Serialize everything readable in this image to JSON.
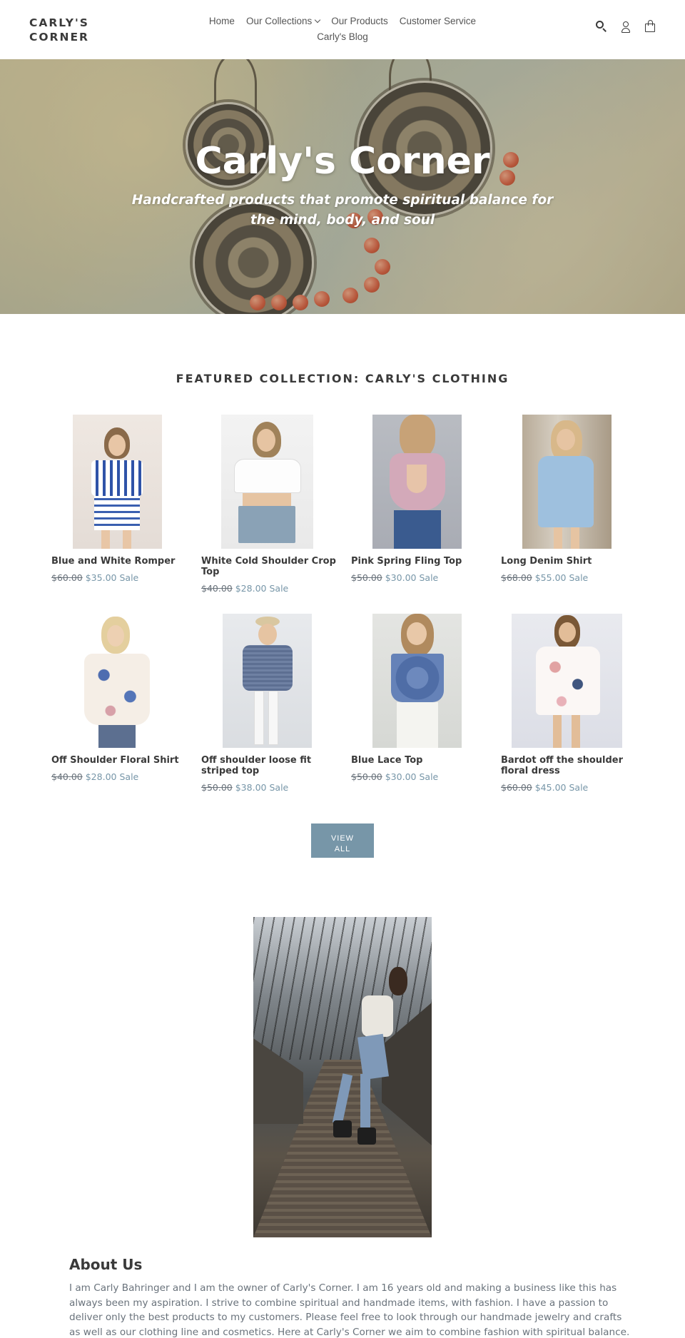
{
  "header": {
    "logo": "CARLY'S CORNER",
    "nav": [
      "Home",
      "Our Collections",
      "Our Products",
      "Customer Service",
      "Carly's Blog"
    ],
    "icons": [
      "search-icon",
      "user-icon",
      "cart-icon"
    ]
  },
  "hero": {
    "title": "Carly's Corner",
    "subtitle": "Handcrafted products that promote spiritual balance for the mind, body, and soul"
  },
  "featured": {
    "title": "FEATURED COLLECTION: CARLY'S CLOTHING",
    "products": [
      {
        "name": "Blue and White Romper",
        "old": "$60.00",
        "new": "$35.00",
        "sale": "Sale"
      },
      {
        "name": "White Cold Shoulder Crop Top",
        "old": "$40.00",
        "new": "$28.00",
        "sale": "Sale"
      },
      {
        "name": "Pink Spring Fling Top",
        "old": "$50.00",
        "new": "$30.00",
        "sale": "Sale"
      },
      {
        "name": "Long Denim Shirt",
        "old": "$68.00",
        "new": "$55.00",
        "sale": "Sale"
      },
      {
        "name": "Off Shoulder Floral Shirt",
        "old": "$40.00",
        "new": "$28.00",
        "sale": "Sale"
      },
      {
        "name": "Off shoulder loose fit striped top",
        "old": "$50.00",
        "new": "$38.00",
        "sale": "Sale"
      },
      {
        "name": "Blue Lace Top",
        "old": "$50.00",
        "new": "$30.00",
        "sale": "Sale"
      },
      {
        "name": "Bardot off the shoulder floral dress",
        "old": "$60.00",
        "new": "$45.00",
        "sale": "Sale"
      }
    ],
    "view_all_line1": "VIEW",
    "view_all_line2": "ALL"
  },
  "about": {
    "title": "About Us",
    "text": "I am Carly Bahringer and I am the owner of Carly's Corner. I am 16 years old and making a business like this has always been my aspiration. I strive to combine spiritual and handmade items, with fashion. I have a passion to deliver only the best products to my customers. Please feel free to look through our handmade jewelry and crafts as well as our clothing line and cosmetics. Here at Carly's Corner we aim to combine fashion with spiritual balance. This is"
  },
  "colors": {
    "accent": "#7796a8",
    "text": "#3a3a3a",
    "muted": "#69727b"
  }
}
